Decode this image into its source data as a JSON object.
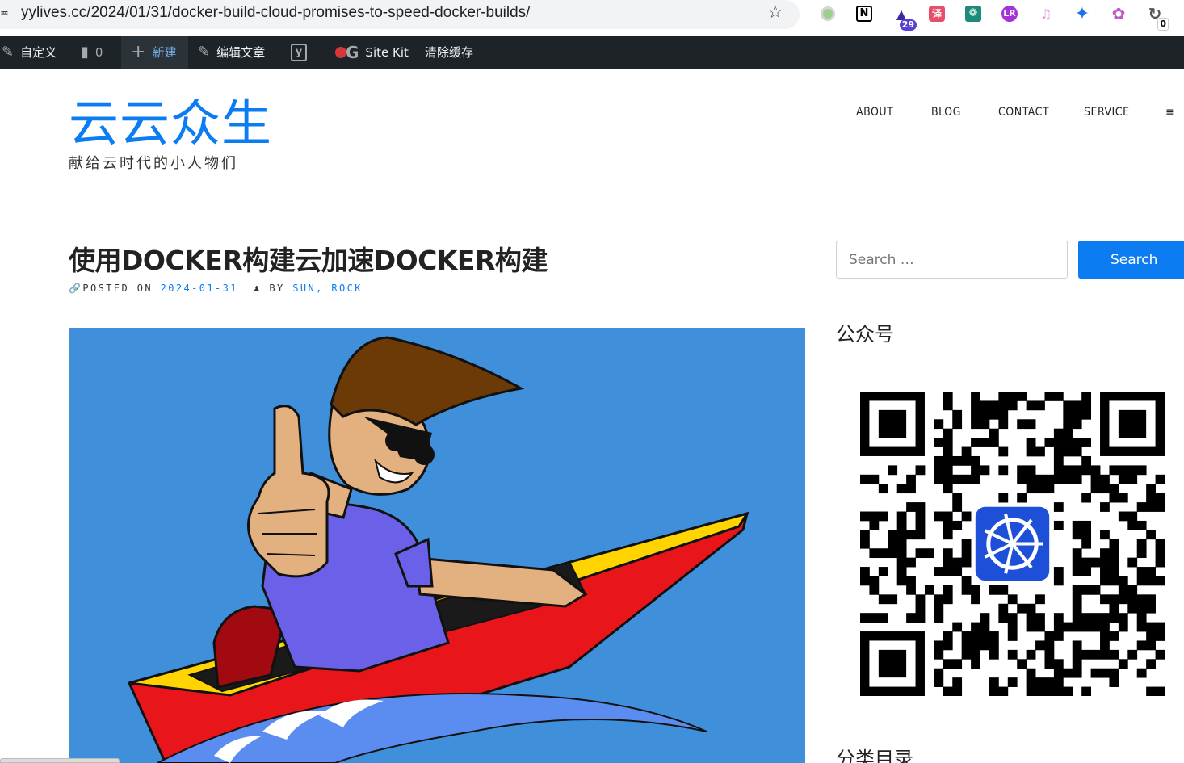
{
  "browser": {
    "url": "yylives.cc/2024/01/31/docker-build-cloud-promises-to-speed-docker-builds/",
    "extensions": [
      {
        "name": "green-dot-extension-icon"
      },
      {
        "name": "notion-extension-icon",
        "glyph": "N"
      },
      {
        "name": "graduation-cap-extension-icon",
        "badge": "29"
      },
      {
        "name": "translate-extension-icon",
        "glyph": "译"
      },
      {
        "name": "teal-extension-icon",
        "glyph": "☸"
      },
      {
        "name": "purple-extension-icon",
        "glyph": "Ⓛ"
      },
      {
        "name": "crown-extension-icon",
        "glyph": "♛"
      },
      {
        "name": "blue-flag-extension-icon",
        "glyph": "⚑"
      },
      {
        "name": "openai-extension-icon",
        "glyph": "✿"
      },
      {
        "name": "refresh-extension-icon",
        "glyph": "↻",
        "badge": "0"
      }
    ]
  },
  "adminbar": {
    "customize": "自定义",
    "comments_count": "0",
    "new": "新建",
    "edit_post": "编辑文章",
    "site_kit": "Site Kit",
    "clear_cache": "清除缓存"
  },
  "site": {
    "title": "云云众生",
    "description": "献给云时代的小人物们"
  },
  "nav": {
    "items": [
      "ABOUT",
      "BLOG",
      "CONTACT",
      "SERVICE"
    ],
    "menu_glyph": "≡"
  },
  "post": {
    "title": "使用DOCKER构建云加速DOCKER构建",
    "posted_on_label": "POSTED ON",
    "date": "2024-01-31",
    "by_label": "BY",
    "authors": "SUN, ROCK"
  },
  "sidebar": {
    "search_placeholder": "Search …",
    "search_button": "Search",
    "widget_wechat": "公众号",
    "widget_categories": "分类目录"
  },
  "colors": {
    "brand": "#0b7cf2",
    "adminbar": "#1d2327",
    "image_bg": "#3f8fdb"
  }
}
